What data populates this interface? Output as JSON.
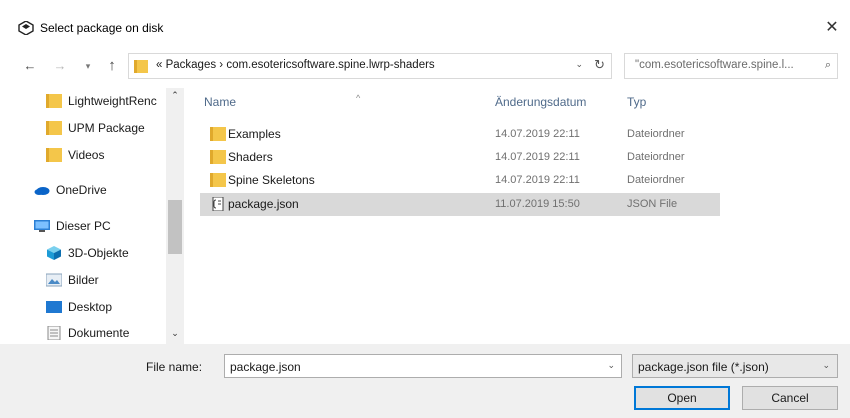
{
  "window": {
    "title": "Select package on disk",
    "close_glyph": "✕"
  },
  "nav": {
    "back_glyph": "←",
    "forward_glyph": "→",
    "recent_glyph": "▾",
    "up_glyph": "↑",
    "address": {
      "text": "« Packages  ›  com.esotericsoftware.spine.lwrp-shaders",
      "chevron_glyph": "⌄",
      "refresh_glyph": "↻"
    },
    "search": {
      "placeholder": "\"com.esotericsoftware.spine.l...",
      "icon_glyph": "⌕"
    }
  },
  "sidebar": {
    "items": [
      {
        "label": "LightweightRenc",
        "icon": "folder-icon"
      },
      {
        "label": "UPM Package",
        "icon": "folder-icon"
      },
      {
        "label": "Videos",
        "icon": "folder-icon"
      },
      {
        "label": "OneDrive",
        "icon": "onedrive-icon"
      },
      {
        "label": "Dieser PC",
        "icon": "pc-icon"
      },
      {
        "label": "3D-Objekte",
        "icon": "3d-objects-icon"
      },
      {
        "label": "Bilder",
        "icon": "pictures-icon"
      },
      {
        "label": "Desktop",
        "icon": "desktop-icon"
      },
      {
        "label": "Dokumente",
        "icon": "documents-icon"
      }
    ],
    "scroll_up_glyph": "⌃",
    "scroll_down_glyph": "⌄"
  },
  "filelist": {
    "columns": {
      "name": "Name",
      "date": "Änderungsdatum",
      "type": "Typ"
    },
    "sort_glyph": "^",
    "rows": [
      {
        "name": "Examples",
        "date": "14.07.2019 22:11",
        "type": "Dateiordner",
        "icon": "folder-icon",
        "selected": false
      },
      {
        "name": "Shaders",
        "date": "14.07.2019 22:11",
        "type": "Dateiordner",
        "icon": "folder-icon",
        "selected": false
      },
      {
        "name": "Spine Skeletons",
        "date": "14.07.2019 22:11",
        "type": "Dateiordner",
        "icon": "folder-icon",
        "selected": false
      },
      {
        "name": "package.json",
        "date": "11.07.2019 15:50",
        "type": "JSON File",
        "icon": "json-file-icon",
        "selected": true
      }
    ]
  },
  "footer": {
    "filename_label": "File name:",
    "filename_value": "package.json",
    "filename_chevron": "⌄",
    "filter_value": "package.json file (*.json)",
    "filter_chevron": "⌄",
    "open_label": "Open",
    "cancel_label": "Cancel"
  },
  "colors": {
    "accent": "#0078d7",
    "folder": "#f4c64a",
    "selected_row": "#d9d9d9",
    "footer_bg": "#f0f0f0"
  }
}
